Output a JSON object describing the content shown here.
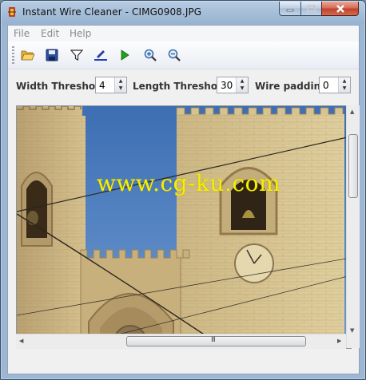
{
  "window": {
    "title": "Instant Wire Cleaner - CIMG0908.JPG",
    "icon": "app-icon",
    "controls": {
      "minimize": "minimize-icon",
      "maximize": "maximize-icon",
      "close": "close-icon"
    }
  },
  "menu": {
    "items": [
      "File",
      "Edit",
      "Help"
    ]
  },
  "toolbar": {
    "buttons": [
      {
        "name": "open-button",
        "icon": "folder-open-icon"
      },
      {
        "name": "save-button",
        "icon": "floppy-disk-icon"
      },
      {
        "name": "filter-button",
        "icon": "funnel-icon"
      },
      {
        "name": "draw-button",
        "icon": "pen-line-icon"
      },
      {
        "name": "run-button",
        "icon": "play-icon"
      },
      {
        "name": "zoom-in-button",
        "icon": "zoom-in-icon"
      },
      {
        "name": "zoom-out-button",
        "icon": "zoom-out-icon"
      }
    ]
  },
  "params": {
    "width_label": "Width Threshold",
    "width_value": "4",
    "length_label": "Length Threshold",
    "length_value": "30",
    "padding_label": "Wire padding",
    "padding_value": "0"
  },
  "image": {
    "watermark": "www.cg-ku.com",
    "sky_color": "#4a78b7",
    "stone_color": "#c9b27a"
  },
  "scrollbars": {
    "h_grip": "III"
  }
}
